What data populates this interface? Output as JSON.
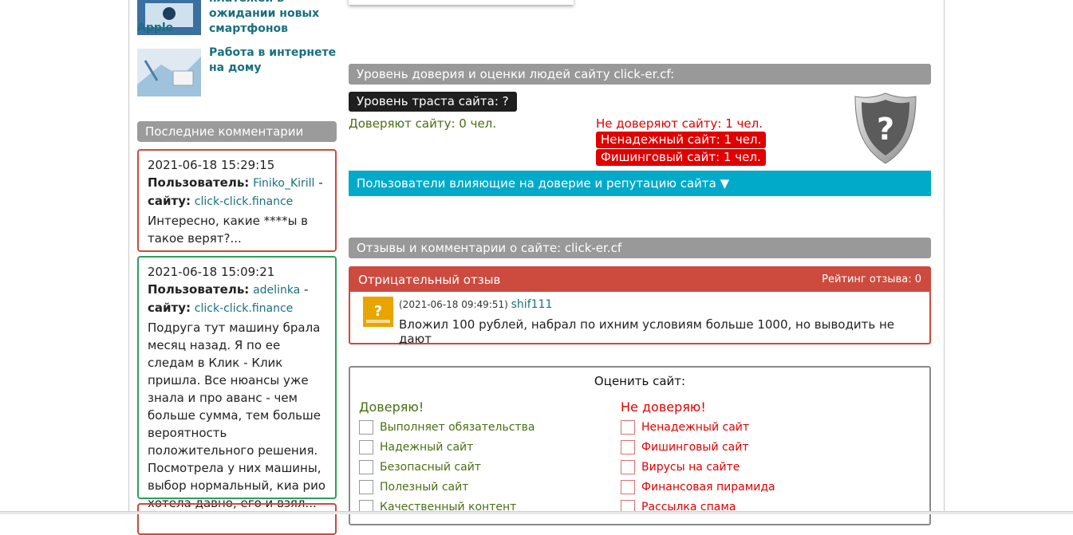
{
  "sidebar": {
    "news": [
      {
        "title": "платежей в ожидании новых смартфонов"
      },
      {
        "title": "Работа в интернете на дому"
      }
    ],
    "apple_label": "Apple",
    "comments_header": "Последние комментарии",
    "comments": [
      {
        "date": "2021-06-18 15:29:15",
        "user_label": "Пользователь:",
        "user": "Finiko_Kirill",
        "site_label": "сайту:",
        "site": "click-click.finance",
        "text": "Интересно, какие ****ы в такое верят?..."
      },
      {
        "date": "2021-06-18 15:09:21",
        "user_label": "Пользователь:",
        "user": "adelinka",
        "site_label": "сайту:",
        "site": "click-click.finance",
        "text": "Подруга тут машину брала месяц назад. Я по ее следам в Клик - Клик пришла. Все нюансы уже знала и про аванс - чем больше сумма, тем больше вероятность положительного решения. Посмотрела у них машины, выбор нормальный, киа рио хотела давно, его и взял..."
      }
    ]
  },
  "trust": {
    "header": "Уровень доверия и оценки людей сайту click-er.cf:",
    "level_badge": "Уровень траста сайта: ?",
    "trust_count": "Доверяют сайту: 0 чел.",
    "distrust_count": "Не доверяют сайту: 1 чел.",
    "tags": [
      "Ненадежный сайт: 1 чел.",
      "Фишинговый сайт: 1 чел."
    ],
    "users_toggle": "Пользователи влияющие на доверие и репутацию сайта ▼"
  },
  "reviews": {
    "header": "Отзывы и комментарии о сайте: click-er.cf",
    "items": [
      {
        "type": "Отрицательный отзыв",
        "rating": "Рейтинг отзыва: 0",
        "date": "(2021-06-18 09:49:51)",
        "user": "shif111",
        "text": "Вложил 100 рублей, набрал по ихним условиям больше 1000, но выводить не дают"
      }
    ]
  },
  "rate": {
    "title": "Оценить сайт:",
    "yes_header": "Доверяю!",
    "no_header": "Не доверяю!",
    "yes_options": [
      "Выполняет обязательства",
      "Надежный сайт",
      "Безопасный сайт",
      "Полезный сайт",
      "Качественный контент"
    ],
    "no_options": [
      "Ненадежный сайт",
      "Фишинговый сайт",
      "Вирусы на сайте",
      "Финансовая пирамида",
      "Рассылка спама"
    ]
  },
  "colors": {
    "accent": "#00aac8",
    "negative": "#cc4a3e",
    "trust": "#4a6f14",
    "distrust": "#e00000"
  }
}
